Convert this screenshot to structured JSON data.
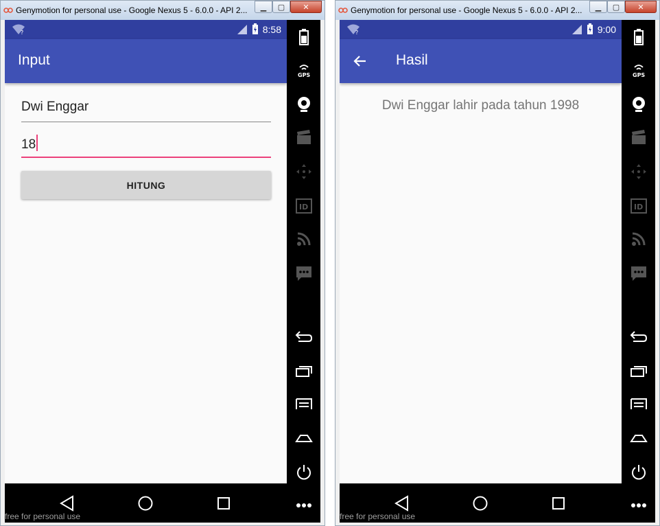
{
  "windows": [
    {
      "title": "Genymotion for personal use - Google Nexus 5 - 6.0.0 - API 2...",
      "status_time": "8:58",
      "appbar_title": "Input",
      "fields": [
        {
          "value": "Dwi Enggar"
        },
        {
          "value": "18"
        }
      ],
      "button_label": "HITUNG",
      "watermark": "free for personal use"
    },
    {
      "title": "Genymotion for personal use - Google Nexus 5 - 6.0.0 - API 2...",
      "status_time": "9:00",
      "appbar_title": "Hasil",
      "result_text": "Dwi Enggar lahir pada tahun 1998",
      "watermark": "free for personal use"
    }
  ],
  "colors": {
    "status_bar": "#303f9f",
    "app_bar": "#3f51b5",
    "accent": "#ec407a",
    "button": "#d6d6d6"
  },
  "side_toolbar_icons": [
    "battery-icon",
    "gps-icon",
    "webcam-icon",
    "capture-icon",
    "dpad-icon",
    "identifier-icon",
    "rss-icon",
    "sms-icon",
    "back-icon",
    "recents-icon",
    "menu-icon",
    "home-icon",
    "power-icon"
  ]
}
